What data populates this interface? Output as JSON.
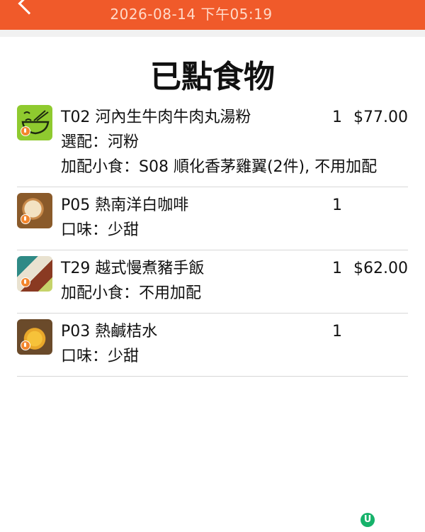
{
  "header": {
    "datetime": "2026-08-14 下午05:19",
    "back_icon": "back-chevron-icon"
  },
  "page": {
    "title": "已點食物"
  },
  "colors": {
    "header_bg": "#f05a2a",
    "header_text": "#ffd9c8",
    "lock_badge": "#f3862d",
    "logo": "#16b26a"
  },
  "items": [
    {
      "name": "T02 河內生牛肉牛肉丸湯粉",
      "qty": "1",
      "price": "$77.00",
      "options": [
        "選配：河粉",
        "加配小食：S08 順化香茅雞翼(2件), 不用加配"
      ],
      "thumb_icon": "noodle-bowl-icon"
    },
    {
      "name": "P05 熱南洋白咖啡",
      "qty": "1",
      "price": "",
      "options": [
        "口味：少甜"
      ],
      "thumb_icon": "coffee-photo"
    },
    {
      "name": "T29 越式慢煮豬手飯",
      "qty": "1",
      "price": "$62.00",
      "options": [
        "加配小食：不用加配"
      ],
      "thumb_icon": "pork-rice-photo"
    },
    {
      "name": "P03 熱鹹桔水",
      "qty": "1",
      "price": "",
      "options": [
        "口味：少甜"
      ],
      "thumb_icon": "kumquat-drink-photo"
    }
  ],
  "footer": {
    "logo_text": "U"
  }
}
